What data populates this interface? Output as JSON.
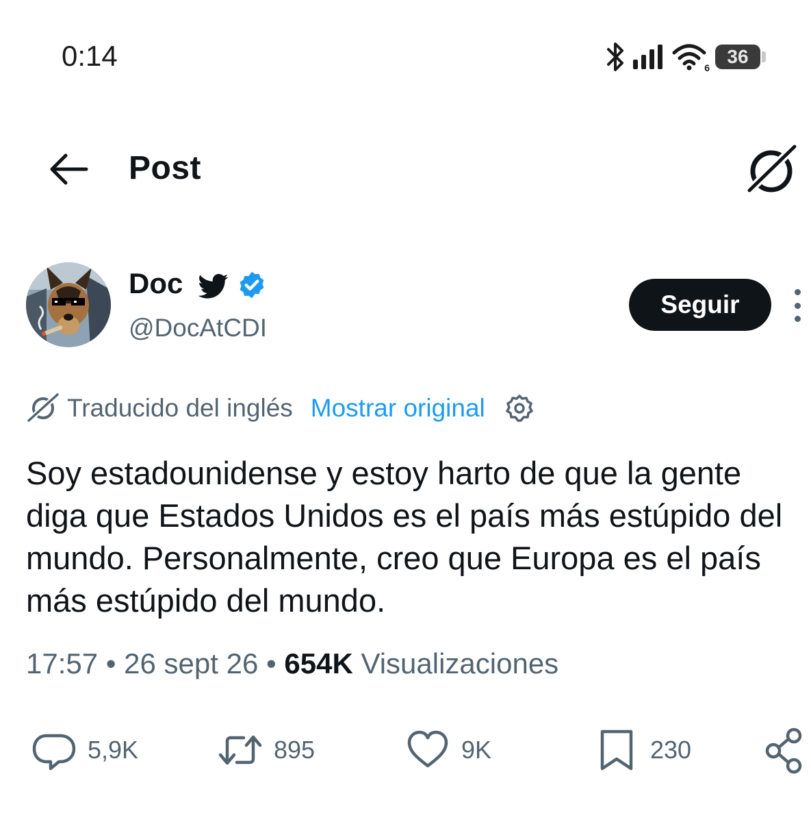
{
  "status_bar": {
    "time": "0:14",
    "wifi_badge": "6",
    "battery_level": "36",
    "icons": [
      "bluetooth-icon",
      "signal-icon",
      "wifi-icon",
      "battery-icon"
    ]
  },
  "header": {
    "title": "Post",
    "back_icon": "arrow-left-icon",
    "grok_icon": "grok-icon"
  },
  "author": {
    "display_name": "Doc",
    "handle": "@DocAtCDI",
    "follow_label": "Seguir",
    "badges": [
      "twitter-bird-icon",
      "verified-icon"
    ]
  },
  "translation": {
    "label": "Traducido del inglés",
    "show_original": "Mostrar original"
  },
  "tweet": {
    "text": "Soy estadounidense y estoy harto de que la gente diga que Estados Unidos es el país más estúpido del mundo. Personalmente, creo que Europa es el país más estúpido del mundo.",
    "time": "17:57",
    "date": "26 sept 26",
    "separator": " • ",
    "views_count": "654K",
    "views_label": "Visualizaciones"
  },
  "actions": {
    "replies": "5,9K",
    "reposts": "895",
    "likes": "9K",
    "bookmarks": "230"
  },
  "colors": {
    "text": "#0f1419",
    "secondary": "#536471",
    "link": "#1d9bf0",
    "verified": "#1d9bf0",
    "follow_bg": "#0f1419"
  }
}
